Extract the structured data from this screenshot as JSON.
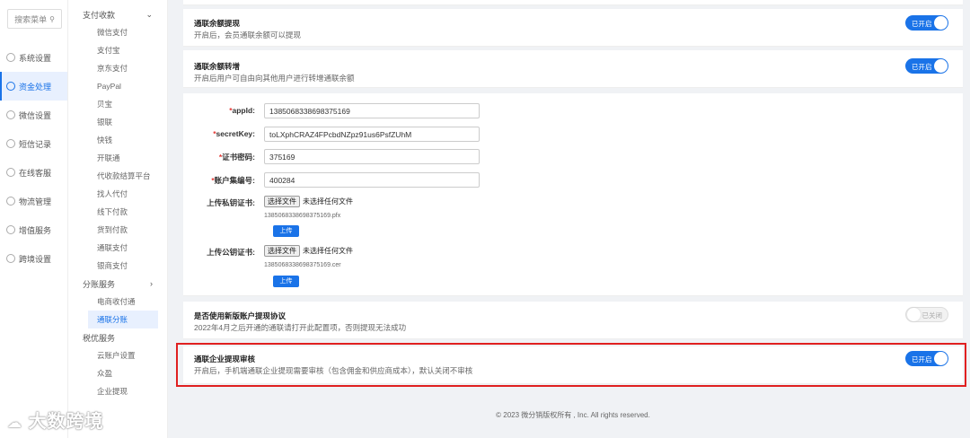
{
  "sidebar": {
    "search_label": "搜索菜单",
    "items": [
      {
        "label": "系统设置",
        "icon": "gear-icon"
      },
      {
        "label": "资金处理",
        "icon": "funds-icon"
      },
      {
        "label": "微信设置",
        "icon": "wechat-icon"
      },
      {
        "label": "短信记录",
        "icon": "sms-icon"
      },
      {
        "label": "在线客服",
        "icon": "service-icon"
      },
      {
        "label": "物流管理",
        "icon": "logistics-icon"
      },
      {
        "label": "增值服务",
        "icon": "value-icon"
      },
      {
        "label": "跨境设置",
        "icon": "globe-icon"
      }
    ]
  },
  "submenu": {
    "groups": [
      {
        "label": "支付收款",
        "items": [
          "微信支付",
          "支付宝",
          "京东支付",
          "PayPal",
          "贝宝",
          "银联",
          "快钱",
          "开联通",
          "代收款结算平台",
          "找人代付",
          "线下付款",
          "货到付款",
          "通联支付",
          "银商支付"
        ]
      },
      {
        "label": "分账服务",
        "items": [
          "电商收付通",
          "通联分账"
        ]
      },
      {
        "label": "税优服务",
        "items": [
          "云账户设置",
          "众盈",
          "企业提现"
        ]
      }
    ]
  },
  "rows": {
    "r1": {
      "title": "通联余额提现",
      "desc": "开启后，会员通联余额可以提现",
      "toggle": "已开启"
    },
    "r2": {
      "title": "通联余额转增",
      "desc": "开启后用户可自由向其他用户进行转增通联余额",
      "toggle": "已开启"
    },
    "r3": {
      "title": "是否使用新版账户提现协议",
      "desc": "2022年4月之后开通的通联请打开此配置项，否则提现无法成功",
      "toggle": "已关闭"
    },
    "r4": {
      "title": "通联企业提现审核",
      "desc": "开启后，手机端通联企业提现需要审核（包含佣金和供应商成本），默认关闭不审核",
      "toggle": "已开启"
    }
  },
  "form": {
    "appid_label": "appId:",
    "appid_value": "1385068338698375169",
    "secret_label": "secretKey:",
    "secret_value": "toLXphCRAZ4FPcbdNZpz91us6PsfZUhM",
    "cert_pwd_label": "证书密码:",
    "cert_pwd_value": "375169",
    "account_label": "账户集编号:",
    "account_value": "400284",
    "private_label": "上传私钥证书:",
    "choose_file": "选择文件",
    "no_file": "未选择任何文件",
    "private_file": "1385068338698375169.pfx",
    "upload": "上传",
    "public_label": "上传公钥证书:",
    "public_file": "1385068338698375169.cer"
  },
  "footer": "© 2023 微分销版权所有 , Inc. All rights reserved.",
  "watermark": "大数跨境"
}
